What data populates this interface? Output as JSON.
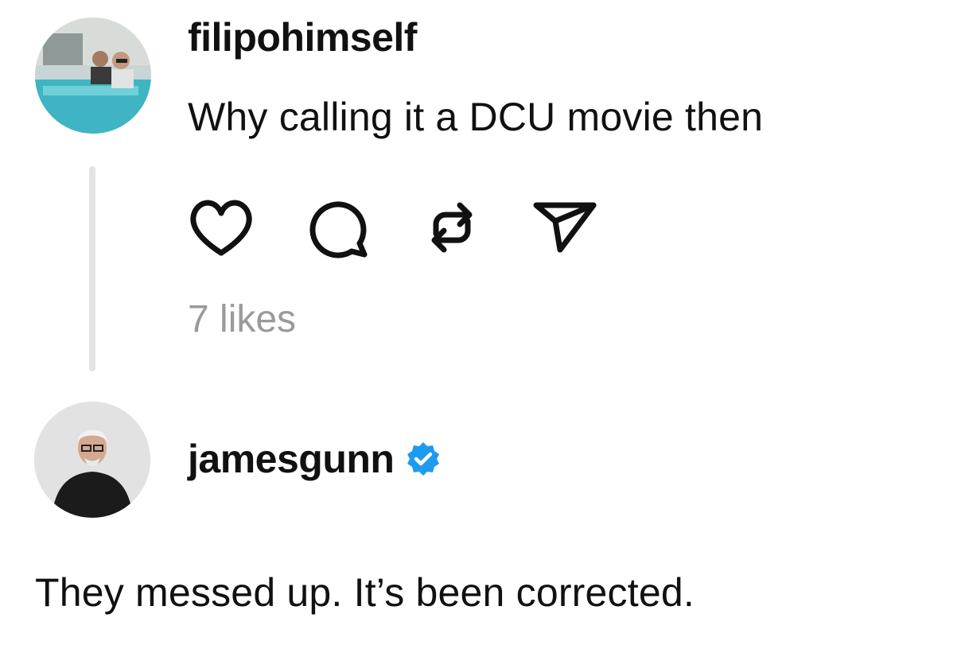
{
  "comments": [
    {
      "username": "filipohimself",
      "text": "Why calling it a DCU movie then",
      "likes": "7 likes",
      "avatar_icon": "profile-photo-two-men-icon"
    },
    {
      "username": "jamesgunn",
      "verified": true,
      "text": "They messed up. It’s been corrected.",
      "avatar_icon": "profile-photo-man-glasses-icon"
    }
  ],
  "actions": [
    "heart-icon",
    "comment-icon",
    "repost-icon",
    "send-icon"
  ],
  "colors": {
    "text": "#111111",
    "muted": "#9a9a9a",
    "thread_line": "#e3e3e3",
    "verified_blue": "#1d9bf0"
  }
}
